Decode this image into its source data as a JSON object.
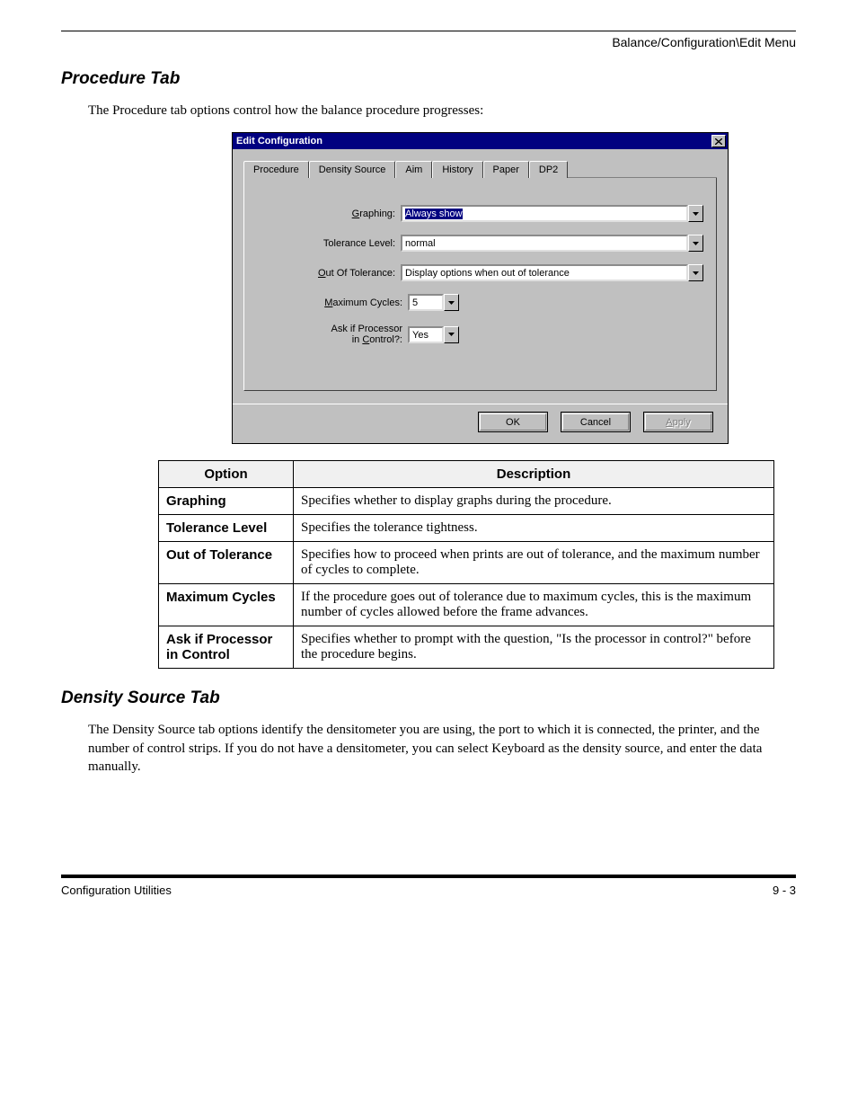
{
  "header": {
    "right": "Balance/Configuration\\Edit Menu"
  },
  "intro": {
    "heading": "Procedure Tab",
    "text": "The Procedure tab options control how the balance procedure progresses:"
  },
  "dialog": {
    "title": "Edit Configuration",
    "tabs": [
      "Procedure",
      "Density Source",
      "Aim",
      "History",
      "Paper",
      "DP2"
    ],
    "active_tab_index": 0,
    "fields": {
      "graphing": {
        "label_pre": "",
        "underline": "G",
        "label_post": "raphing:",
        "value": "Always show"
      },
      "tolerance": {
        "label": "Tolerance Level:",
        "value": "normal"
      },
      "out_of_tolerance": {
        "label_pre": "",
        "underline": "O",
        "label_post": "ut Of Tolerance:",
        "value": "Display options when out of tolerance"
      },
      "max_cycles": {
        "label_pre": "",
        "underline": "M",
        "label_post": "aximum Cycles:",
        "value": "5"
      },
      "ask_processor": {
        "label_line1": "Ask if Processor",
        "label_line2_pre": "in ",
        "underline": "C",
        "label_line2_post": "ontrol?:",
        "value": "Yes"
      }
    },
    "buttons": {
      "ok": "OK",
      "cancel": "Cancel",
      "apply_u": "A",
      "apply_rest": "pply"
    }
  },
  "table": {
    "headers": [
      "Option",
      "Description"
    ],
    "rows": [
      {
        "opt": "Graphing",
        "desc": "Specifies whether to display graphs during the procedure."
      },
      {
        "opt": "Tolerance Level",
        "desc": "Specifies the tolerance tightness."
      },
      {
        "opt": "Out of Tolerance",
        "desc": "Specifies how to proceed when prints are out of tolerance, and the maximum number of cycles to complete."
      },
      {
        "opt": "Maximum Cycles",
        "desc": "If the procedure goes out of tolerance due to maximum cycles, this is the maximum number of cycles allowed before the frame advances."
      },
      {
        "opt": "Ask if Processor in Control",
        "desc": "Specifies whether to prompt with the question, \"Is the processor in control?\" before the procedure begins."
      }
    ]
  },
  "density_section": {
    "heading": "Density Source Tab",
    "text": "The Density Source tab options identify the densitometer you are using, the port to which it is connected, the printer, and the number of control strips. If you do not have a densitometer, you can select Keyboard as the density source, and enter the data manually."
  },
  "footer": {
    "left": "Configuration Utilities",
    "right": "9 - 3"
  }
}
